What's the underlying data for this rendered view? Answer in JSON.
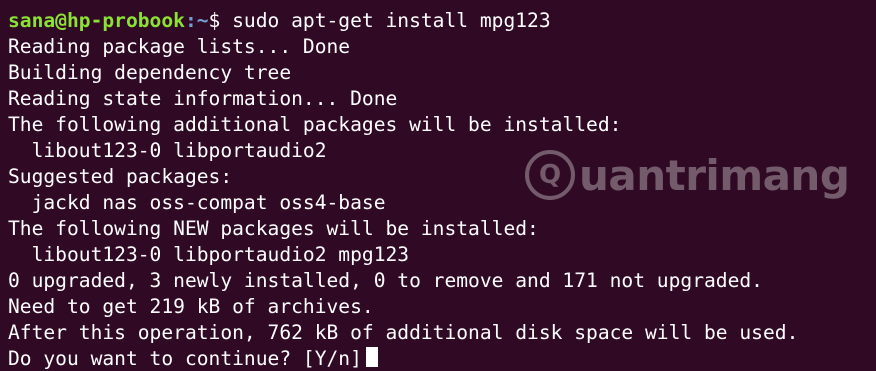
{
  "prompt": {
    "user_host": "sana@hp-probook",
    "path": ":~",
    "symbol": "$",
    "command": " sudo apt-get install mpg123"
  },
  "output_lines": [
    "Reading package lists... Done",
    "Building dependency tree",
    "Reading state information... Done",
    "The following additional packages will be installed:",
    "  libout123-0 libportaudio2",
    "Suggested packages:",
    "  jackd nas oss-compat oss4-base",
    "The following NEW packages will be installed:",
    "  libout123-0 libportaudio2 mpg123",
    "0 upgraded, 3 newly installed, 0 to remove and 171 not upgraded.",
    "Need to get 219 kB of archives.",
    "After this operation, 762 kB of additional disk space will be used."
  ],
  "confirm_prompt": "Do you want to continue? [Y/n]",
  "watermark": {
    "text": "uantrimang",
    "logo_letter": "Q"
  },
  "colors": {
    "background": "#300a24",
    "text": "#ffffff",
    "user_host": "#8ae234",
    "path": "#729fcf"
  }
}
